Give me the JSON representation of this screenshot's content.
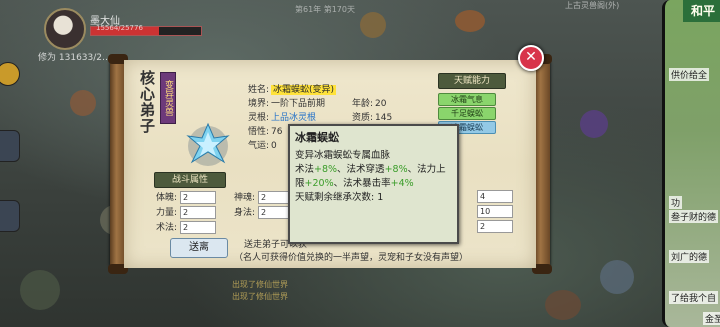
{
  "hud": {
    "player_name": "墨大仙",
    "hp_text": "15564/25776",
    "power_label": "修为",
    "power_value": "131633/2…",
    "day_counter": "第61年 第170天",
    "top_right_label": "上古灵兽阁(外)"
  },
  "dialog": {
    "title_vertical": "核心弟子",
    "title_banner": "变异灵兽",
    "close_symbol": "✕",
    "info": {
      "name_label": "姓名:",
      "name_value": "冰霜蜈蚣(变异)",
      "realm_label": "境界:",
      "realm_value": "一阶下品前期",
      "age_label": "年龄:",
      "age_value": "20",
      "root_label": "灵根:",
      "root_value": "上品冰灵根",
      "aptitude_label": "资质:",
      "aptitude_value": "145",
      "wisdom_label": "悟性:",
      "wisdom_value": "76",
      "luck_label": "气运:",
      "luck_value": "0"
    },
    "talent": {
      "title": "天赋能力",
      "items": [
        "冰霜气息",
        "千足蜈蚣",
        "冰霜蜈蚣"
      ]
    },
    "combat": {
      "title": "战斗属性",
      "attrs": [
        {
          "label": "体魄:",
          "value": "2"
        },
        {
          "label": "神魂:",
          "value": "2"
        },
        {
          "label": "力量:",
          "value": "2"
        },
        {
          "label": "身法:",
          "value": "2"
        },
        {
          "label": "术法:",
          "value": "2"
        }
      ],
      "right_values": [
        "4",
        "10",
        "2"
      ]
    },
    "dismiss_button": "送离",
    "dismiss_note_1": "送走弟子可以获",
    "dismiss_note_2": "（名人可获得价值兑换的一半声望，灵宠和子女没有声望）"
  },
  "tooltip": {
    "title": "冰霜蜈蚣",
    "line1": "变异冰霜蜈蚣专属血脉",
    "line2_a": "术法",
    "line2_b": "+8%",
    "line2_c": "、法术穿透",
    "line2_d": "+8%",
    "line2_e": "、法力上",
    "line3_a": "限",
    "line3_b": "+20%",
    "line3_c": "、法术暴击率",
    "line3_d": "+4%",
    "line4": "天赋剩余继承次数: 1"
  },
  "right_panel": {
    "brand": "和平",
    "texts": [
      "供价给全",
      "功",
      "叁子财的德",
      "刘广的德",
      "了给我个自",
      "金圣"
    ]
  },
  "bottom_log": [
    "出现了修仙世界",
    "出现了修仙世界"
  ]
}
